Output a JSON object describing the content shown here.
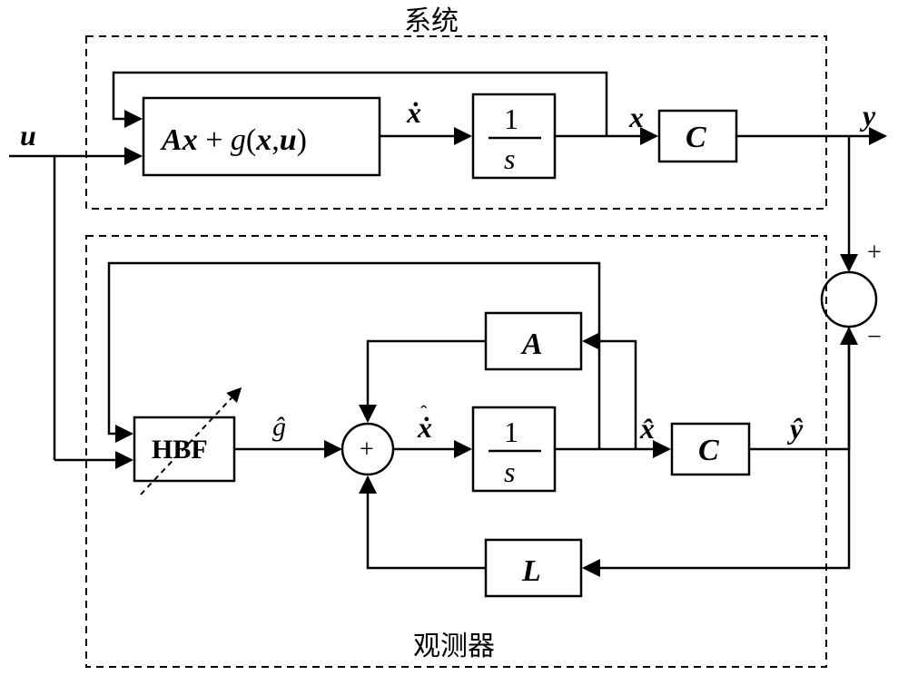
{
  "diagram": {
    "system_label": "系统",
    "observer_label": "观测器",
    "input_u": "u",
    "block_sys_eq_A": "A",
    "block_sys_eq_x1": "x",
    "block_sys_eq_plus": " + ",
    "block_sys_eq_g": "g",
    "block_sys_eq_paren_l": "(",
    "block_sys_eq_x2": "x",
    "block_sys_eq_comma": ",",
    "block_sys_eq_u": "u",
    "block_sys_eq_paren_r": ")",
    "sig_xdot": "ẋ",
    "integrator_num": "1",
    "integrator_den": "s",
    "sig_x": "x",
    "block_C": "C",
    "sig_y": "y",
    "summing_plus": "+",
    "summing_minus": "−",
    "summing_plus2": "+",
    "block_HBF": "HBF",
    "sig_ghat": "ĝ",
    "block_A": "A",
    "sig_xhatdot_hat": "ˆ",
    "sig_xhatdot": "ẋ",
    "sig_xhat": "x̂",
    "block_C2": "C",
    "sig_yhat": "ŷ",
    "block_L": "L"
  }
}
